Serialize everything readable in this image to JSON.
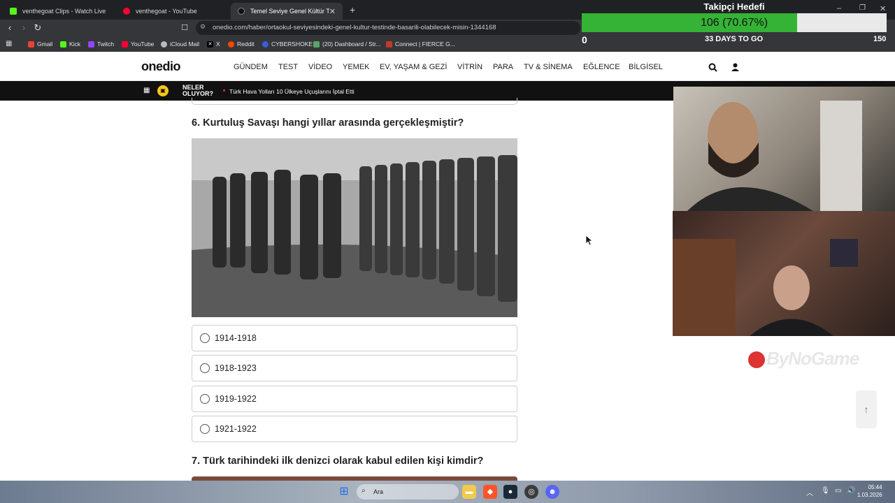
{
  "browser": {
    "tabs": [
      {
        "title": "venthegoat Clips - Watch Live on Kick",
        "icon_color": "#53fc18"
      },
      {
        "title": "venthegoat - YouTube",
        "icon_color": "#ff0033"
      },
      {
        "title": "Temel Seviye Genel Kültür Testin",
        "icon_color": "#222222"
      }
    ],
    "url": "onedio.com/haber/ortaokul-seviyesindeki-genel-kultur-testinde-basarili-olabilecek-misin-1344168",
    "bookmarks": [
      {
        "label": "Gmail",
        "icon_color": "#ea4335"
      },
      {
        "label": "Kick",
        "icon_color": "#53fc18"
      },
      {
        "label": "Twitch",
        "icon_color": "#9146ff"
      },
      {
        "label": "YouTube",
        "icon_color": "#ff0033"
      },
      {
        "label": "iCloud Mail",
        "icon_color": "#bbbbbb"
      },
      {
        "label": "X",
        "icon_color": "#000000"
      },
      {
        "label": "Reddit",
        "icon_color": "#ff4500"
      },
      {
        "label": "CYBERSHOKE",
        "icon_color": "#3b5bdb"
      },
      {
        "label": "(20) Dashboard / Str...",
        "icon_color": "#5aa469"
      },
      {
        "label": "Connect | FIERCE G...",
        "icon_color": "#c0392b"
      }
    ]
  },
  "overlay": {
    "goal_title": "Takipçi Hedefi",
    "goal_text": "106 (70.67%)",
    "goal_fraction": 0.7067,
    "goal_min": "0",
    "goal_days": "33 DAYS TO GO",
    "goal_max": "150",
    "fill_color": "#35b336",
    "watermark": "ByNoGame"
  },
  "site": {
    "logo": "onedio",
    "nav": [
      "GÜNDEM",
      "TEST",
      "VİDEO",
      "YEMEK",
      "EV, YAŞAM & GEZİ",
      "VİTRİN",
      "PARA",
      "TV & SİNEMA",
      "EĞLENCE",
      "BİLGİSEL"
    ],
    "ticker_label_1": "NELER",
    "ticker_label_2": "OLUYOR?",
    "ticker_text": "Türk Hava Yolları 10 Ülkeye Uçuşlarını İptal Etti"
  },
  "quiz": {
    "q6_title": "6. Kurtuluş Savaşı hangi yıllar arasında gerçekleşmiştir?",
    "options": [
      "1914-1918",
      "1918-1923",
      "1919-1922",
      "1921-1922"
    ],
    "q7_title": "7. Türk tarihindeki ilk denizci olarak kabul edilen kişi kimdir?"
  },
  "taskbar": {
    "search": "Ara",
    "time": "05:44",
    "date": "1.03.2026"
  }
}
